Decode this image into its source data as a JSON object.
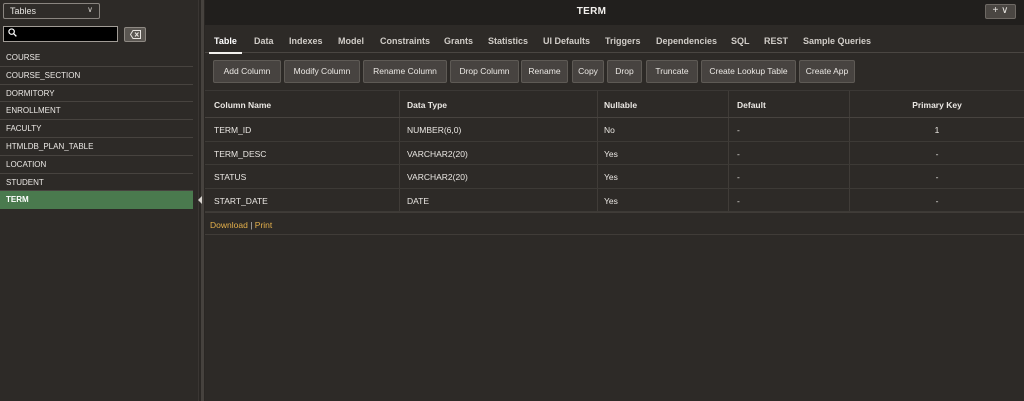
{
  "left_panel": {
    "object_type_select": "Tables",
    "search_placeholder": "",
    "items": [
      "COURSE",
      "COURSE_SECTION",
      "DORMITORY",
      "ENROLLMENT",
      "FACULTY",
      "HTMLDB_PLAN_TABLE",
      "LOCATION",
      "STUDENT",
      "TERM"
    ],
    "selected": "TERM"
  },
  "header": {
    "title": "TERM",
    "add_button": "+ ∨"
  },
  "tabs": [
    "Table",
    "Data",
    "Indexes",
    "Model",
    "Constraints",
    "Grants",
    "Statistics",
    "UI Defaults",
    "Triggers",
    "Dependencies",
    "SQL",
    "REST",
    "Sample Queries"
  ],
  "active_tab": "Table",
  "toolbar": [
    "Add Column",
    "Modify Column",
    "Rename Column",
    "Drop Column",
    "Rename",
    "Copy",
    "Drop",
    "Truncate",
    "Create Lookup Table",
    "Create App"
  ],
  "grid": {
    "headers": [
      "Column Name",
      "Data Type",
      "Nullable",
      "Default",
      "Primary Key"
    ],
    "rows": [
      [
        "TERM_ID",
        "NUMBER(6,0)",
        "No",
        "-",
        "1"
      ],
      [
        "TERM_DESC",
        "VARCHAR2(20)",
        "Yes",
        "-",
        "-"
      ],
      [
        "STATUS",
        "VARCHAR2(20)",
        "Yes",
        "-",
        "-"
      ],
      [
        "START_DATE",
        "DATE",
        "Yes",
        "-",
        "-"
      ]
    ]
  },
  "footer": {
    "download": "Download",
    "separator": "|",
    "print": "Print"
  },
  "colors": {
    "accent_selected": "#4a7a4e",
    "link": "#e4b04b",
    "background": "#2d2a27",
    "titlebar": "#211f1d"
  }
}
